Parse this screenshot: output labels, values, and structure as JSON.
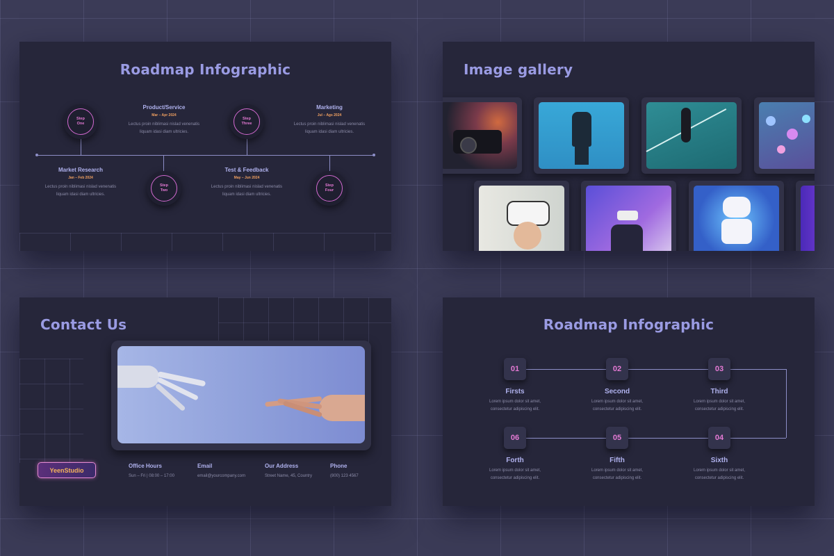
{
  "slide1": {
    "title": "Roadmap Infographic",
    "steps": [
      {
        "line1": "Step",
        "line2": "One"
      },
      {
        "line1": "Step",
        "line2": "Two"
      },
      {
        "line1": "Step",
        "line2": "Three"
      },
      {
        "line1": "Step",
        "line2": "Four"
      }
    ],
    "phases": [
      {
        "title": "Market Research",
        "date": "Jan – Feb 2024",
        "desc": "Lectus proin niblimasi nislad venenatis liquam idasi diam ultricies."
      },
      {
        "title": "Product/Service",
        "date": "Mar – Apr 2024",
        "desc": "Lectus proin niblimasi nislad venenatis liquam idasi diam ultricies."
      },
      {
        "title": "Test & Feedback",
        "date": "May – Jun 2024",
        "desc": "Lectus proin niblimasi nislad venenatis liquam idasi diam ultricies."
      },
      {
        "title": "Marketing",
        "date": "Jul – Ags 2024",
        "desc": "Lectus proin niblimasi nislad venenatis liquam idasi diam ultricies."
      }
    ]
  },
  "slide2": {
    "title": "Image gallery",
    "photos": [
      "video-camera-photo",
      "robot-hand-photo",
      "person-on-court-photo",
      "molecule-model-photo",
      "vr-headset-child-photo",
      "vr-headset-man-photo",
      "toy-robot-photo",
      "purple-edge-photo"
    ]
  },
  "slide3": {
    "title": "Contact Us",
    "brand": "YeenStudio",
    "contacts": [
      {
        "heading": "Office Hours",
        "value": "Sun – Fri | 08:00 – 17:00"
      },
      {
        "heading": "Email",
        "value": "email@yourcompany.com"
      },
      {
        "heading": "Our Address",
        "value": "Street Name, 45, Country"
      },
      {
        "heading": "Phone",
        "value": "(800) 123 4567"
      }
    ]
  },
  "slide4": {
    "title": "Roadmap Infographic",
    "items": [
      {
        "num": "01",
        "label": "Firsts",
        "desc1": "Lorem ipsum dolor sit amet,",
        "desc2": "consectetur adipiscing elit."
      },
      {
        "num": "02",
        "label": "Second",
        "desc1": "Lorem ipsum dolor sit amet,",
        "desc2": "consectetur adipiscing elit."
      },
      {
        "num": "03",
        "label": "Third",
        "desc1": "Lorem ipsum dolor sit amet,",
        "desc2": "consectetur adipiscing elit."
      },
      {
        "num": "06",
        "label": "Forth",
        "desc1": "Lorem ipsum dolor sit amet,",
        "desc2": "consectetur adipiscing elit."
      },
      {
        "num": "05",
        "label": "Fifth",
        "desc1": "Lorem ipsum dolor sit amet,",
        "desc2": "consectetur adipiscing elit."
      },
      {
        "num": "04",
        "label": "Sixth",
        "desc1": "Lorem ipsum dolor sit amet,",
        "desc2": "consectetur adipiscing elit."
      }
    ]
  },
  "colors": {
    "background": "#3b3b57",
    "slide": "#26263a",
    "title": "#9a9be3",
    "accent": "#e57ad5",
    "date": "#f0a060"
  }
}
